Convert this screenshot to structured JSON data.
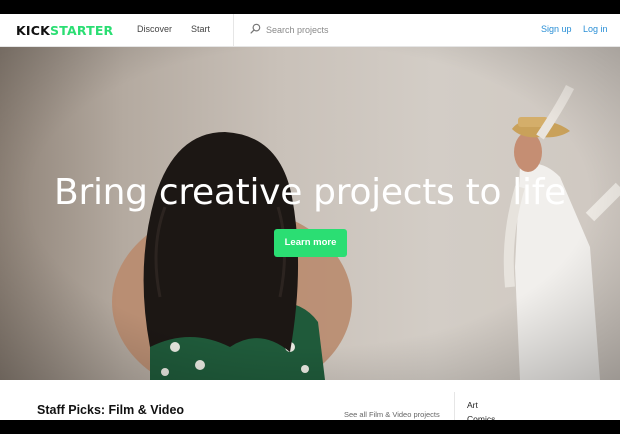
{
  "header": {
    "logo_part1": "KICK",
    "logo_part2": "STARTER",
    "nav": [
      "Discover",
      "Start"
    ],
    "search_placeholder": "Search projects",
    "signup_label": "Sign up",
    "login_label": "Log in"
  },
  "hero": {
    "title": "Bring creative projects to life",
    "button_label": "Learn more"
  },
  "staff_picks": {
    "title": "Staff Picks: Film & Video",
    "see_all": "See all Film & Video projects"
  },
  "categories": [
    "Art",
    "Comics"
  ],
  "colors": {
    "brand_green": "#2bde73",
    "link_blue": "#2a8fd6"
  }
}
